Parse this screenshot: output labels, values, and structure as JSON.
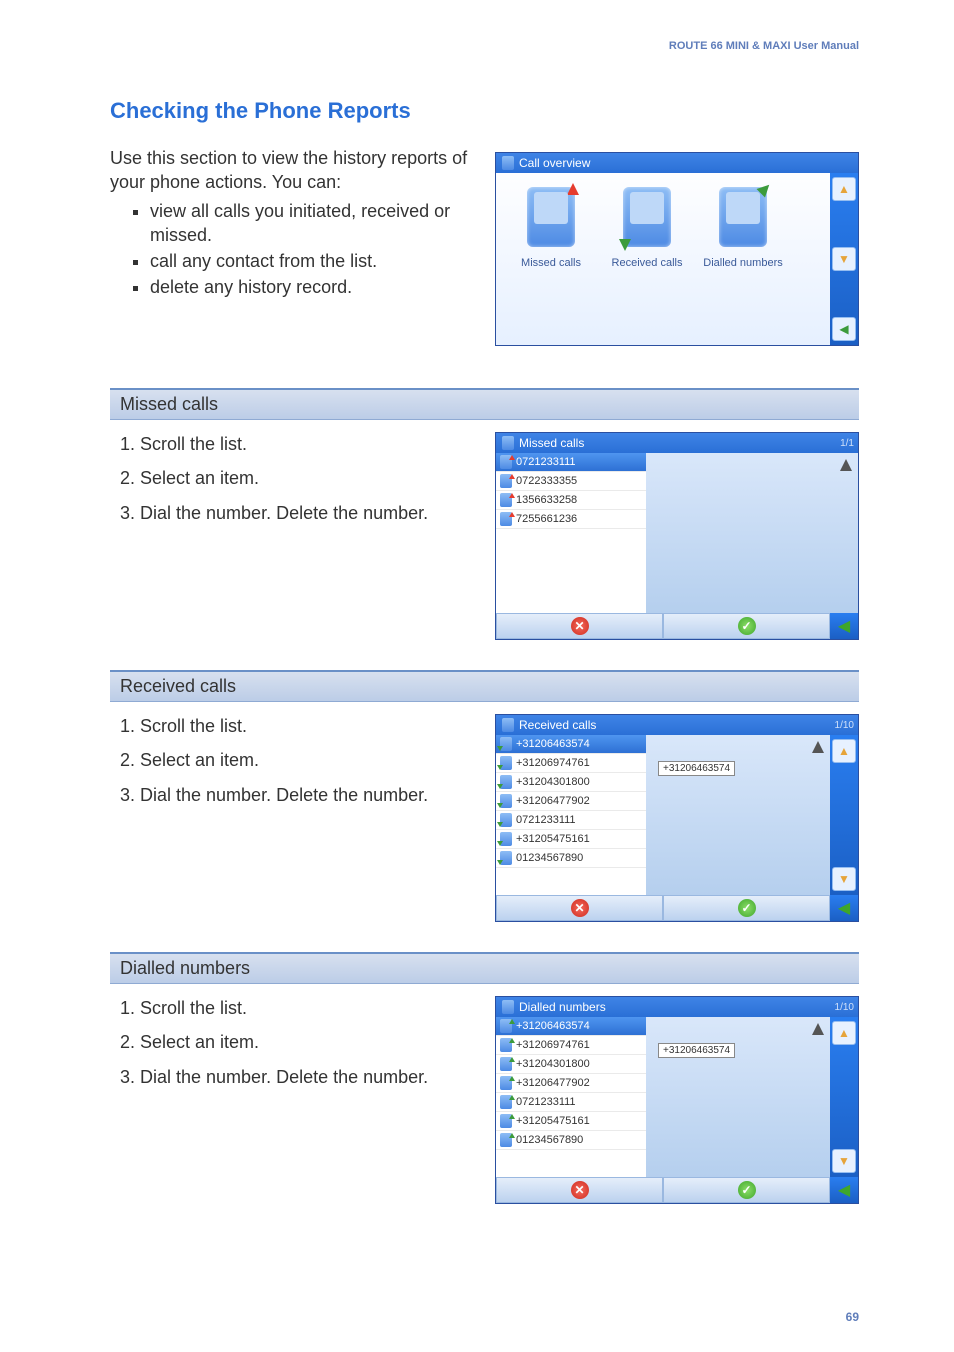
{
  "header": "ROUTE 66 MINI & MAXI User Manual",
  "title": "Checking the Phone Reports",
  "intro": {
    "lead": "Use this section to view the history reports of your phone actions. You can:",
    "bullets": [
      "view all calls you initiated, received or missed.",
      "call any contact from the list.",
      "delete any history record."
    ]
  },
  "overview": {
    "title": "Call overview",
    "items": [
      "Missed calls",
      "Received calls",
      "Dialled numbers"
    ]
  },
  "sections": [
    {
      "heading": "Missed calls",
      "steps": [
        "Scroll the list.",
        "Select an item.",
        "Dial the number. Delete the number."
      ],
      "screen": {
        "title": "Missed calls",
        "pageInfo": "1/1",
        "iconType": "out",
        "rows": [
          {
            "num": "0721233111",
            "sel": true
          },
          {
            "num": "0722333355",
            "sel": false
          },
          {
            "num": "1356633258",
            "sel": false
          },
          {
            "num": "7255661236",
            "sel": false
          }
        ],
        "tooltip": "",
        "showSideNav": false
      }
    },
    {
      "heading": "Received calls",
      "steps": [
        "Scroll the list.",
        "Select an item.",
        "Dial the number. Delete the number."
      ],
      "screen": {
        "title": "Received calls",
        "pageInfo": "1/10",
        "iconType": "in",
        "rows": [
          {
            "num": "+31206463574",
            "sel": true
          },
          {
            "num": "+31206974761",
            "sel": false
          },
          {
            "num": "+31204301800",
            "sel": false
          },
          {
            "num": "+31206477902",
            "sel": false
          },
          {
            "num": "0721233111",
            "sel": false
          },
          {
            "num": "+31205475161",
            "sel": false
          },
          {
            "num": "01234567890",
            "sel": false
          }
        ],
        "tooltip": "+31206463574",
        "showSideNav": true
      }
    },
    {
      "heading": "Dialled numbers",
      "steps": [
        "Scroll the list.",
        "Select an item.",
        "Dial the number. Delete the number."
      ],
      "screen": {
        "title": "Dialled numbers",
        "pageInfo": "1/10",
        "iconType": "dial",
        "rows": [
          {
            "num": "+31206463574",
            "sel": true
          },
          {
            "num": "+31206974761",
            "sel": false
          },
          {
            "num": "+31204301800",
            "sel": false
          },
          {
            "num": "+31206477902",
            "sel": false
          },
          {
            "num": "0721233111",
            "sel": false
          },
          {
            "num": "+31205475161",
            "sel": false
          },
          {
            "num": "01234567890",
            "sel": false
          }
        ],
        "tooltip": "+31206463574",
        "showSideNav": true
      }
    }
  ],
  "pageNumber": "69"
}
